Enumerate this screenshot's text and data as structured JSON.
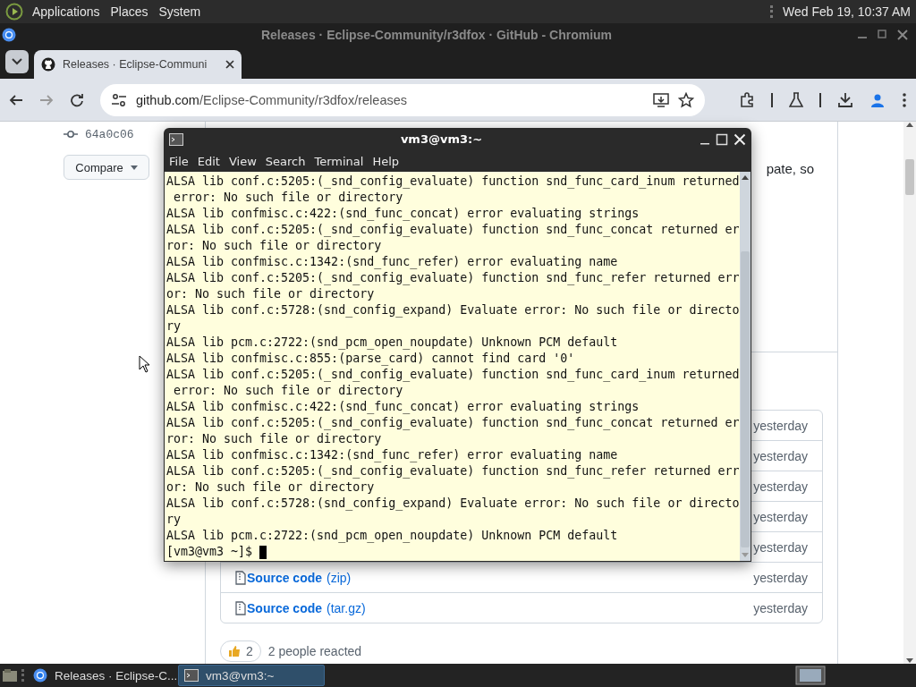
{
  "top_panel": {
    "menus": [
      "Applications",
      "Places",
      "System"
    ],
    "clock": "Wed Feb 19, 10:37 AM"
  },
  "browser": {
    "title": "Releases · Eclipse-Community/r3dfox · GitHub - Chromium",
    "tabs": [
      {
        "label": "Releases · Eclipse-Communi",
        "selected": true
      }
    ],
    "url": {
      "host": "github.com",
      "path": "/Eclipse-Community/r3dfox/releases"
    },
    "page": {
      "commit": "64a0c06",
      "compare_button": "Compare",
      "body_text": "pate, so",
      "assets": [
        {
          "date": "yesterday"
        },
        {
          "date": "yesterday"
        },
        {
          "date": "yesterday"
        },
        {
          "date": "yesterday"
        },
        {
          "date": "yesterday"
        },
        {
          "name": "Source code",
          "ext": "(zip)",
          "date": "yesterday"
        },
        {
          "name": "Source code",
          "ext": "(tar.gz)",
          "date": "yesterday"
        }
      ],
      "reactions": {
        "count": "2",
        "summary": "2 people reacted"
      }
    }
  },
  "terminal": {
    "title": "vm3@vm3:~",
    "menus": [
      "File",
      "Edit",
      "View",
      "Search",
      "Terminal",
      "Help"
    ],
    "lines": [
      "ALSA lib conf.c:5205:(_snd_config_evaluate) function snd_func_card_inum returned",
      " error: No such file or directory",
      "ALSA lib confmisc.c:422:(snd_func_concat) error evaluating strings",
      "ALSA lib conf.c:5205:(_snd_config_evaluate) function snd_func_concat returned er",
      "ror: No such file or directory",
      "ALSA lib confmisc.c:1342:(snd_func_refer) error evaluating name",
      "ALSA lib conf.c:5205:(_snd_config_evaluate) function snd_func_refer returned err",
      "or: No such file or directory",
      "ALSA lib conf.c:5728:(snd_config_expand) Evaluate error: No such file or directo",
      "ry",
      "ALSA lib pcm.c:2722:(snd_pcm_open_noupdate) Unknown PCM default",
      "ALSA lib confmisc.c:855:(parse_card) cannot find card '0'",
      "ALSA lib conf.c:5205:(_snd_config_evaluate) function snd_func_card_inum returned",
      " error: No such file or directory",
      "ALSA lib confmisc.c:422:(snd_func_concat) error evaluating strings",
      "ALSA lib conf.c:5205:(_snd_config_evaluate) function snd_func_concat returned er",
      "ror: No such file or directory",
      "ALSA lib confmisc.c:1342:(snd_func_refer) error evaluating name",
      "ALSA lib conf.c:5205:(_snd_config_evaluate) function snd_func_refer returned err",
      "or: No such file or directory",
      "ALSA lib conf.c:5728:(snd_config_expand) Evaluate error: No such file or directo",
      "ry",
      "ALSA lib pcm.c:2722:(snd_pcm_open_noupdate) Unknown PCM default"
    ],
    "prompt": "[vm3@vm3 ~]$"
  },
  "taskbar": {
    "items": [
      {
        "label": "Releases · Eclipse-C...",
        "kind": "browser",
        "selected": false
      },
      {
        "label": "vm3@vm3:~",
        "kind": "terminal",
        "selected": true
      }
    ]
  }
}
